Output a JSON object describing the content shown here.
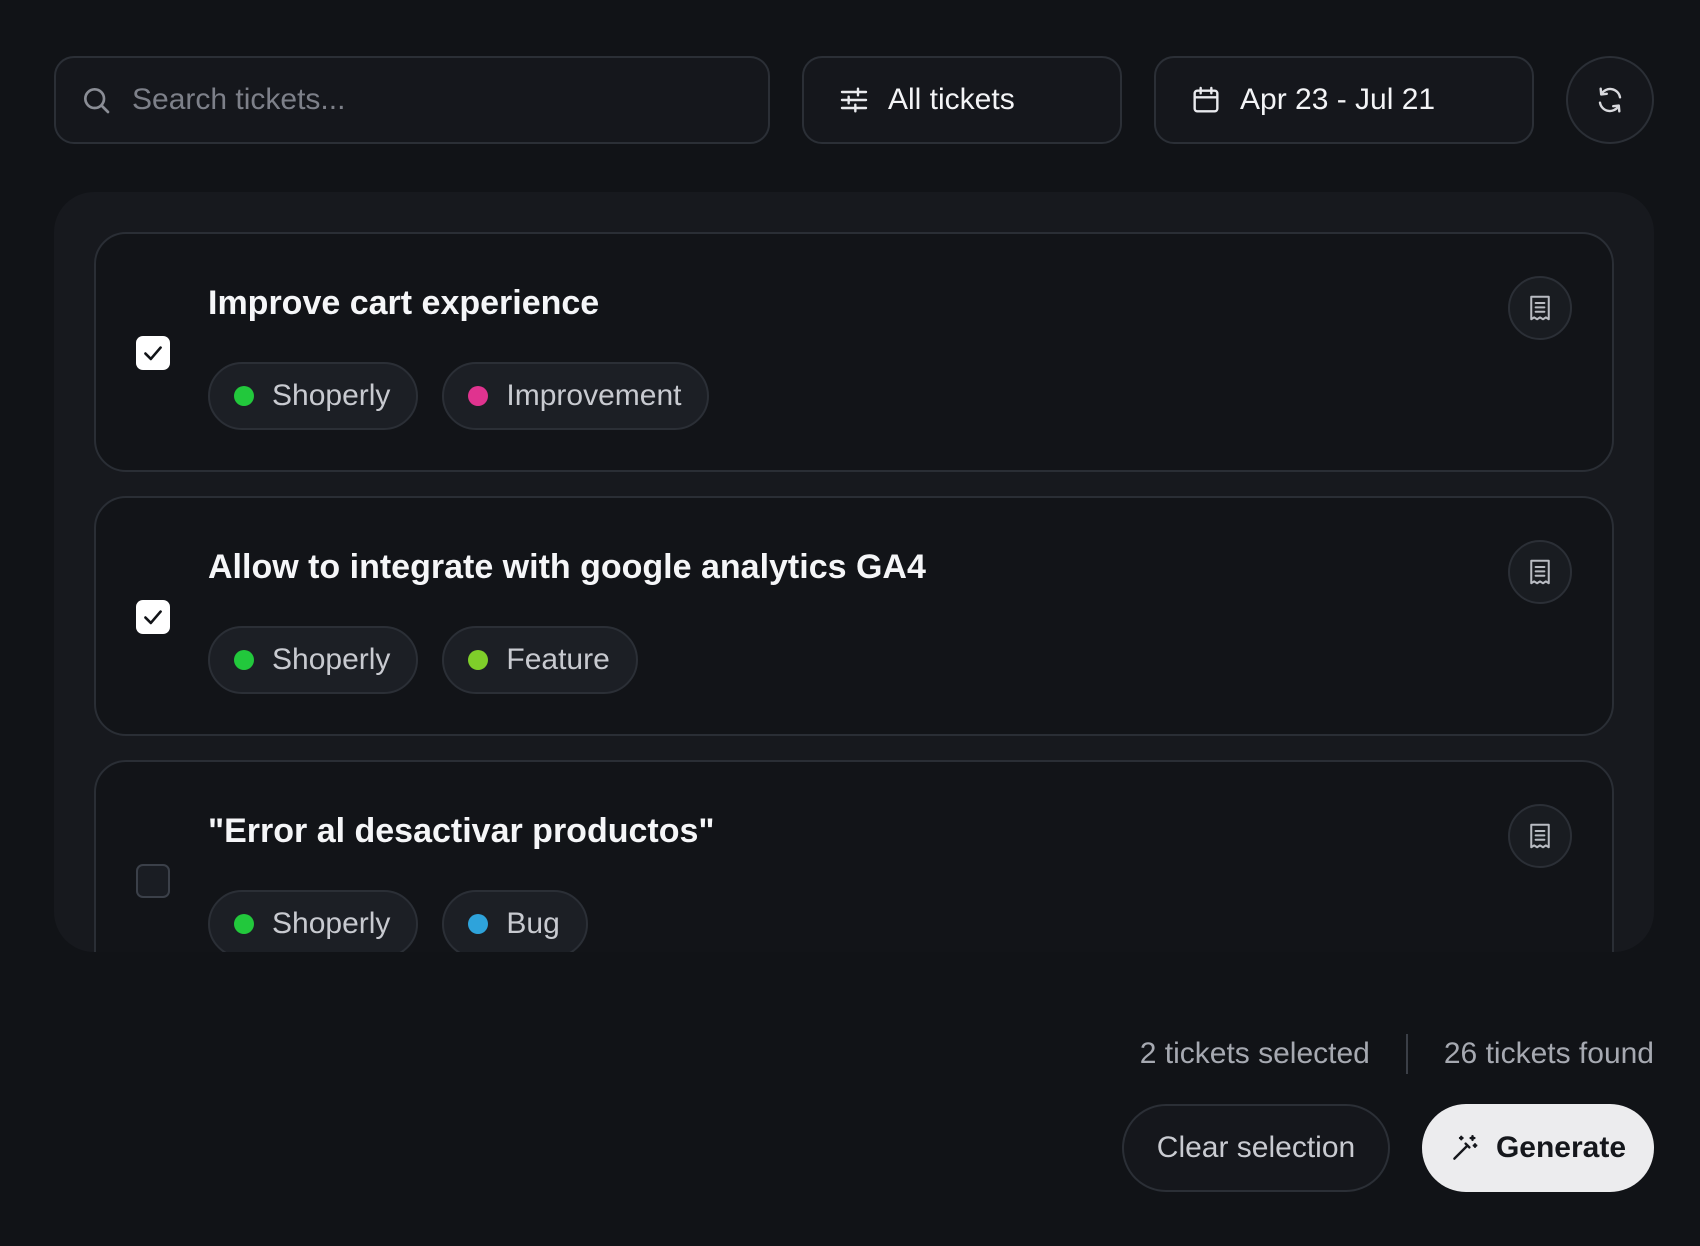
{
  "toolbar": {
    "search": {
      "placeholder": "Search tickets...",
      "value": "",
      "icon": "search-icon"
    },
    "filter": {
      "label": "All tickets",
      "icon": "sliders-icon"
    },
    "date_range": {
      "label": "Apr 23 - Jul 21",
      "icon": "calendar-icon"
    },
    "refresh": {
      "icon": "refresh-icon"
    }
  },
  "tickets": [
    {
      "title": "Improve cart experience",
      "checked": true,
      "tags": [
        {
          "label": "Shoperly",
          "color": "#22c83c"
        },
        {
          "label": "Improvement",
          "color": "#e0338f"
        }
      ]
    },
    {
      "title": "Allow to integrate with google analytics GA4",
      "checked": true,
      "tags": [
        {
          "label": "Shoperly",
          "color": "#22c83c"
        },
        {
          "label": "Feature",
          "color": "#7fcf2a"
        }
      ]
    },
    {
      "title": "\"Error al desactivar productos\"",
      "checked": false,
      "tags": [
        {
          "label": "Shoperly",
          "color": "#22c83c"
        },
        {
          "label": "Bug",
          "color": "#2ea3db"
        }
      ]
    }
  ],
  "footer": {
    "selected_text": "2 tickets selected",
    "found_text": "26 tickets found",
    "clear_label": "Clear selection",
    "generate_label": "Generate",
    "generate_icon": "magic-wand-icon"
  }
}
